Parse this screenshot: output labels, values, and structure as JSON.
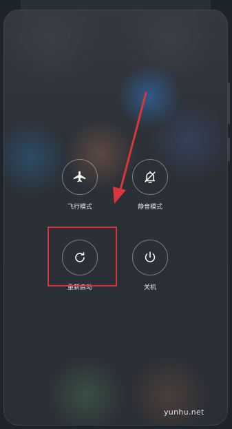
{
  "power_menu": {
    "buttons": [
      {
        "id": "airplane",
        "label": "飞行模式",
        "icon": "airplane-icon"
      },
      {
        "id": "silent",
        "label": "静音模式",
        "icon": "bell-off-icon"
      },
      {
        "id": "restart",
        "label": "重新启动",
        "icon": "restart-icon",
        "highlighted": true
      },
      {
        "id": "shutdown",
        "label": "关机",
        "icon": "power-icon"
      }
    ]
  },
  "annotation": {
    "highlight_color": "#d8363c",
    "arrow_color": "#d8363c"
  },
  "watermark": "yunhu.net"
}
